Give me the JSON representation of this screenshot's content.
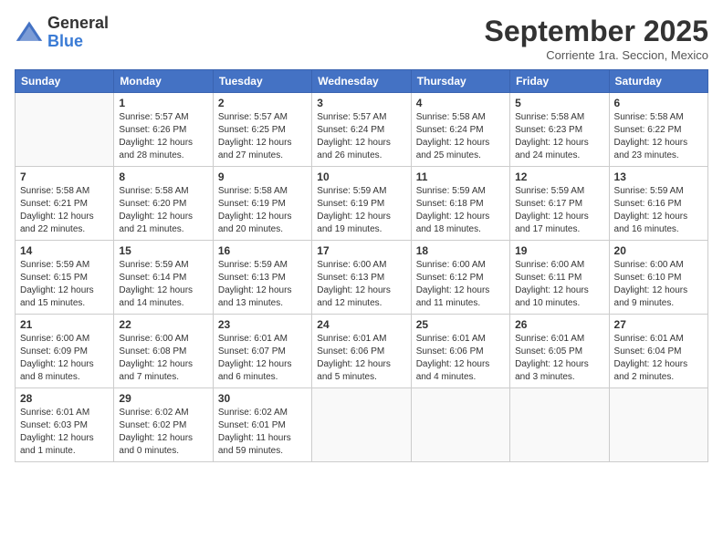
{
  "header": {
    "logo_general": "General",
    "logo_blue": "Blue",
    "month_title": "September 2025",
    "location": "Corriente 1ra. Seccion, Mexico"
  },
  "weekdays": [
    "Sunday",
    "Monday",
    "Tuesday",
    "Wednesday",
    "Thursday",
    "Friday",
    "Saturday"
  ],
  "weeks": [
    [
      {
        "day": "",
        "empty": true
      },
      {
        "day": "1",
        "sunrise": "5:57 AM",
        "sunset": "6:26 PM",
        "daylight": "12 hours and 28 minutes."
      },
      {
        "day": "2",
        "sunrise": "5:57 AM",
        "sunset": "6:25 PM",
        "daylight": "12 hours and 27 minutes."
      },
      {
        "day": "3",
        "sunrise": "5:57 AM",
        "sunset": "6:24 PM",
        "daylight": "12 hours and 26 minutes."
      },
      {
        "day": "4",
        "sunrise": "5:58 AM",
        "sunset": "6:24 PM",
        "daylight": "12 hours and 25 minutes."
      },
      {
        "day": "5",
        "sunrise": "5:58 AM",
        "sunset": "6:23 PM",
        "daylight": "12 hours and 24 minutes."
      },
      {
        "day": "6",
        "sunrise": "5:58 AM",
        "sunset": "6:22 PM",
        "daylight": "12 hours and 23 minutes."
      }
    ],
    [
      {
        "day": "7",
        "sunrise": "5:58 AM",
        "sunset": "6:21 PM",
        "daylight": "12 hours and 22 minutes."
      },
      {
        "day": "8",
        "sunrise": "5:58 AM",
        "sunset": "6:20 PM",
        "daylight": "12 hours and 21 minutes."
      },
      {
        "day": "9",
        "sunrise": "5:58 AM",
        "sunset": "6:19 PM",
        "daylight": "12 hours and 20 minutes."
      },
      {
        "day": "10",
        "sunrise": "5:59 AM",
        "sunset": "6:19 PM",
        "daylight": "12 hours and 19 minutes."
      },
      {
        "day": "11",
        "sunrise": "5:59 AM",
        "sunset": "6:18 PM",
        "daylight": "12 hours and 18 minutes."
      },
      {
        "day": "12",
        "sunrise": "5:59 AM",
        "sunset": "6:17 PM",
        "daylight": "12 hours and 17 minutes."
      },
      {
        "day": "13",
        "sunrise": "5:59 AM",
        "sunset": "6:16 PM",
        "daylight": "12 hours and 16 minutes."
      }
    ],
    [
      {
        "day": "14",
        "sunrise": "5:59 AM",
        "sunset": "6:15 PM",
        "daylight": "12 hours and 15 minutes."
      },
      {
        "day": "15",
        "sunrise": "5:59 AM",
        "sunset": "6:14 PM",
        "daylight": "12 hours and 14 minutes."
      },
      {
        "day": "16",
        "sunrise": "5:59 AM",
        "sunset": "6:13 PM",
        "daylight": "12 hours and 13 minutes."
      },
      {
        "day": "17",
        "sunrise": "6:00 AM",
        "sunset": "6:13 PM",
        "daylight": "12 hours and 12 minutes."
      },
      {
        "day": "18",
        "sunrise": "6:00 AM",
        "sunset": "6:12 PM",
        "daylight": "12 hours and 11 minutes."
      },
      {
        "day": "19",
        "sunrise": "6:00 AM",
        "sunset": "6:11 PM",
        "daylight": "12 hours and 10 minutes."
      },
      {
        "day": "20",
        "sunrise": "6:00 AM",
        "sunset": "6:10 PM",
        "daylight": "12 hours and 9 minutes."
      }
    ],
    [
      {
        "day": "21",
        "sunrise": "6:00 AM",
        "sunset": "6:09 PM",
        "daylight": "12 hours and 8 minutes."
      },
      {
        "day": "22",
        "sunrise": "6:00 AM",
        "sunset": "6:08 PM",
        "daylight": "12 hours and 7 minutes."
      },
      {
        "day": "23",
        "sunrise": "6:01 AM",
        "sunset": "6:07 PM",
        "daylight": "12 hours and 6 minutes."
      },
      {
        "day": "24",
        "sunrise": "6:01 AM",
        "sunset": "6:06 PM",
        "daylight": "12 hours and 5 minutes."
      },
      {
        "day": "25",
        "sunrise": "6:01 AM",
        "sunset": "6:06 PM",
        "daylight": "12 hours and 4 minutes."
      },
      {
        "day": "26",
        "sunrise": "6:01 AM",
        "sunset": "6:05 PM",
        "daylight": "12 hours and 3 minutes."
      },
      {
        "day": "27",
        "sunrise": "6:01 AM",
        "sunset": "6:04 PM",
        "daylight": "12 hours and 2 minutes."
      }
    ],
    [
      {
        "day": "28",
        "sunrise": "6:01 AM",
        "sunset": "6:03 PM",
        "daylight": "12 hours and 1 minute."
      },
      {
        "day": "29",
        "sunrise": "6:02 AM",
        "sunset": "6:02 PM",
        "daylight": "12 hours and 0 minutes."
      },
      {
        "day": "30",
        "sunrise": "6:02 AM",
        "sunset": "6:01 PM",
        "daylight": "11 hours and 59 minutes."
      },
      {
        "day": "",
        "empty": true
      },
      {
        "day": "",
        "empty": true
      },
      {
        "day": "",
        "empty": true
      },
      {
        "day": "",
        "empty": true
      }
    ]
  ],
  "labels": {
    "sunrise_prefix": "Sunrise: ",
    "sunset_prefix": "Sunset: ",
    "daylight_prefix": "Daylight: "
  }
}
